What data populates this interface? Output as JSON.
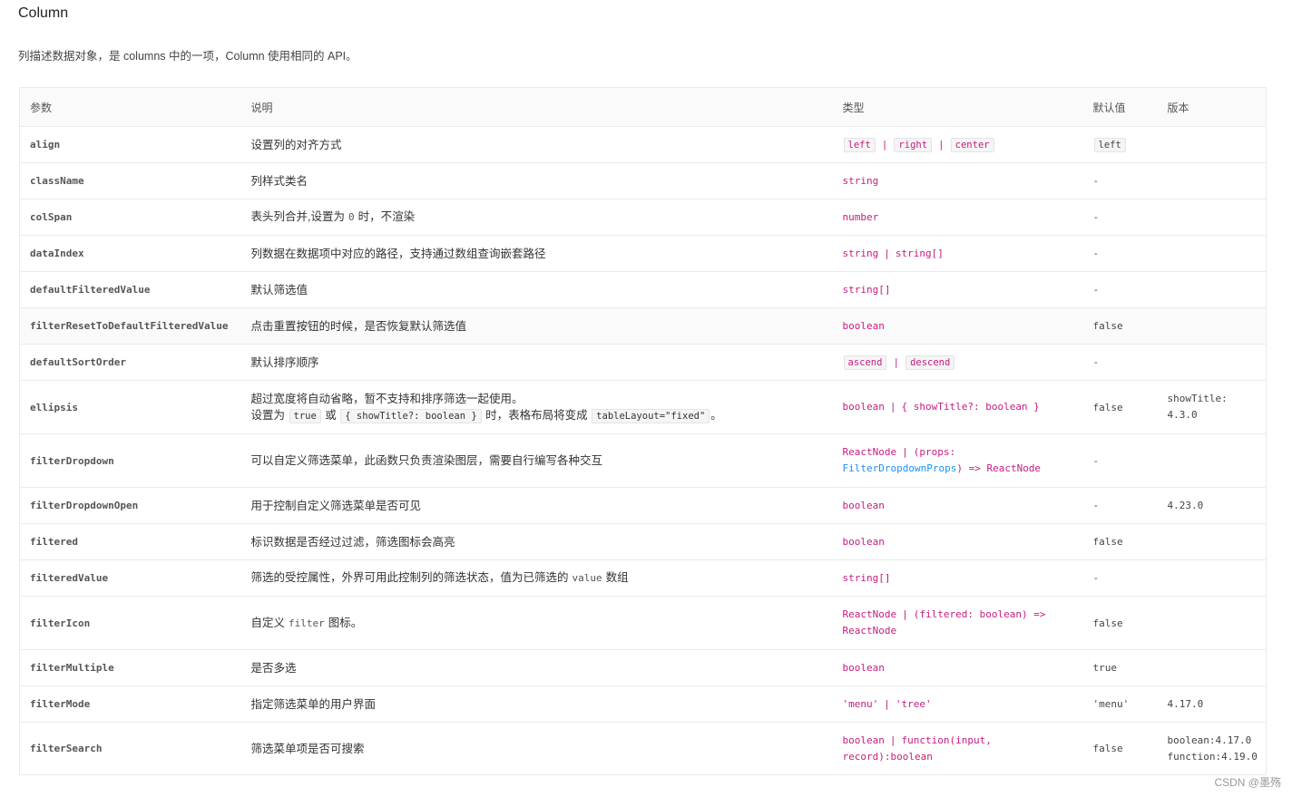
{
  "title": "Column",
  "description": "列描述数据对象，是 columns 中的一项，Column 使用相同的 API。",
  "headers": {
    "param": "参数",
    "desc": "说明",
    "type": "类型",
    "default": "默认值",
    "version": "版本"
  },
  "rows": {
    "align": {
      "param": "align",
      "desc": "设置列的对齐方式",
      "type": [
        "left",
        "right",
        "center"
      ],
      "default": "left",
      "version": ""
    },
    "className": {
      "param": "className",
      "desc": "列样式类名",
      "type": "string",
      "default": "-",
      "version": ""
    },
    "colSpan": {
      "param": "colSpan",
      "desc_pre": "表头列合并,设置为",
      "desc_code": "0",
      "desc_post": "时，不渲染",
      "type": "number",
      "default": "-",
      "version": ""
    },
    "dataIndex": {
      "param": "dataIndex",
      "desc": "列数据在数据项中对应的路径，支持通过数组查询嵌套路径",
      "type_a": "string",
      "type_b": "string[]",
      "default": "-",
      "version": ""
    },
    "defaultFilteredValue": {
      "param": "defaultFilteredValue",
      "desc": "默认筛选值",
      "type": "string[]",
      "default": "-",
      "version": ""
    },
    "filterResetToDefaultFilteredValue": {
      "param": "filterResetToDefaultFilteredValue",
      "desc": "点击重置按钮的时候，是否恢复默认筛选值",
      "type": "boolean",
      "default": "false",
      "version": ""
    },
    "defaultSortOrder": {
      "param": "defaultSortOrder",
      "desc": "默认排序顺序",
      "type": [
        "ascend",
        "descend"
      ],
      "default": "-",
      "version": ""
    },
    "ellipsis": {
      "param": "ellipsis",
      "desc_line1": "超过宽度将自动省略，暂不支持和排序筛选一起使用。",
      "desc_l2_pre": "设置为",
      "desc_l2_code1": "true",
      "desc_l2_or": "或",
      "desc_l2_code2": "{ showTitle?: boolean }",
      "desc_l2_mid": "时，表格布局将变成",
      "desc_l2_code3": "tableLayout=\"fixed\"",
      "desc_l2_end": "。",
      "type_a": "boolean",
      "type_b": "{ showTitle?: boolean }",
      "default": "false",
      "version_line1": "showTitle:",
      "version_line2": "4.3.0"
    },
    "filterDropdown": {
      "param": "filterDropdown",
      "desc": "可以自定义筛选菜单，此函数只负责渲染图层，需要自行编写各种交互",
      "type_l1_a": "ReactNode",
      "type_l1_b": "(props:",
      "type_l2_a": "FilterDropdownProps",
      "type_l2_b": ") => ReactNode",
      "default": "-",
      "version": ""
    },
    "filterDropdownOpen": {
      "param": "filterDropdownOpen",
      "desc": "用于控制自定义筛选菜单是否可见",
      "type": "boolean",
      "default": "-",
      "version": "4.23.0"
    },
    "filtered": {
      "param": "filtered",
      "desc": "标识数据是否经过过滤，筛选图标会高亮",
      "type": "boolean",
      "default": "false",
      "version": ""
    },
    "filteredValue": {
      "param": "filteredValue",
      "desc_pre": "筛选的受控属性，外界可用此控制列的筛选状态，值为已筛选的",
      "desc_code": "value",
      "desc_post": "数组",
      "type": "string[]",
      "default": "-",
      "version": ""
    },
    "filterIcon": {
      "param": "filterIcon",
      "desc_pre": "自定义",
      "desc_code": "filter",
      "desc_post": "图标。",
      "type_l1_a": "ReactNode",
      "type_l1_b": "(filtered: boolean) =>",
      "type_l2": "ReactNode",
      "default": "false",
      "version": ""
    },
    "filterMultiple": {
      "param": "filterMultiple",
      "desc": "是否多选",
      "type": "boolean",
      "default": "true",
      "version": ""
    },
    "filterMode": {
      "param": "filterMode",
      "desc": "指定筛选菜单的用户界面",
      "type_a": "'menu'",
      "type_b": "'tree'",
      "default": "'menu'",
      "version": "4.17.0"
    },
    "filterSearch": {
      "param": "filterSearch",
      "desc": "筛选菜单项是否可搜索",
      "type_l1_a": "boolean",
      "type_l1_b": "function(input,",
      "type_l2": "record):boolean",
      "default": "false",
      "version_line1": "boolean:4.17.0",
      "version_line2": "function:4.19.0"
    }
  },
  "separator": "|",
  "watermark": "CSDN @墨殇"
}
